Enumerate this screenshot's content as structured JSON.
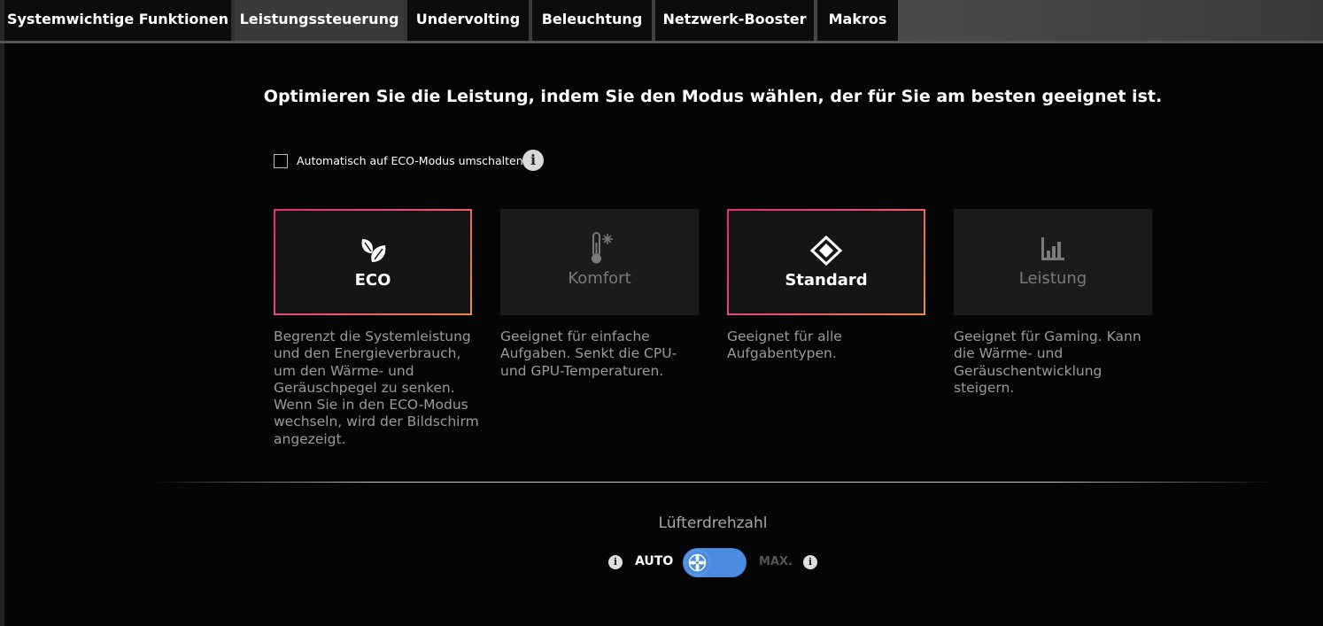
{
  "tabs": [
    {
      "label": "Systemwichtige Funktionen",
      "active": false
    },
    {
      "label": "Leistungssteuerung",
      "active": true
    },
    {
      "label": "Undervolting",
      "active": false
    },
    {
      "label": "Beleuchtung",
      "active": false
    },
    {
      "label": "Netzwerk-Booster",
      "active": false
    },
    {
      "label": "Makros",
      "active": false
    }
  ],
  "headline": "Optimieren Sie die Leistung, indem Sie den Modus wählen, der für Sie am besten geeignet ist.",
  "auto_eco": {
    "label": "Automatisch auf ECO-Modus umschalten",
    "checked": false,
    "info_icon": "info-icon"
  },
  "modes": [
    {
      "label": "ECO",
      "icon": "leaf-icon",
      "selected": true,
      "enabled": true,
      "description": "Begrenzt die Systemleistung und den Energieverbrauch, um den Wärme- und Geräuschpegel zu senken. Wenn Sie in den ECO-Modus wechseln, wird der Bildschirm angezeigt."
    },
    {
      "label": "Komfort",
      "icon": "thermometer-snowflake-icon",
      "selected": false,
      "enabled": false,
      "description": "Geeignet für einfache Aufgaben. Senkt die CPU- und GPU-Temperaturen."
    },
    {
      "label": "Standard",
      "icon": "diamond-icon",
      "selected": true,
      "enabled": true,
      "description": "Geeignet für alle Aufgabentypen."
    },
    {
      "label": "Leistung",
      "icon": "bar-chart-icon",
      "selected": false,
      "enabled": false,
      "description": "Geeignet für Gaming. Kann die Wärme- und Geräuschentwicklung steigern."
    }
  ],
  "fan": {
    "title": "Lüfterdrehzahl",
    "auto_label": "AUTO",
    "max_label": "MAX.",
    "mode": "AUTO",
    "colors": {
      "toggle": "#4a8de0"
    }
  },
  "colors": {
    "accent_gradient_start": "#e0306a",
    "accent_gradient_end": "#f08a3a"
  }
}
